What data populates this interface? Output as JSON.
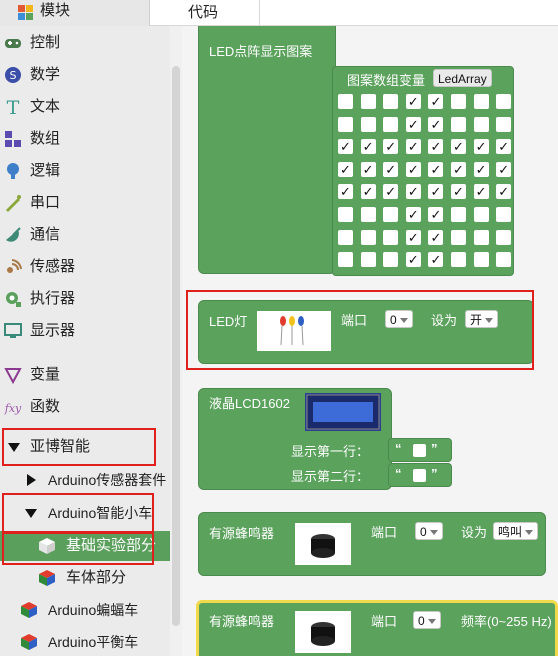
{
  "tabs": {
    "modules": "模块",
    "code": "代码"
  },
  "sidebar": {
    "items": [
      {
        "label": "控制",
        "icon": "gamepad-icon"
      },
      {
        "label": "数学",
        "icon": "math-icon"
      },
      {
        "label": "文本",
        "icon": "text-icon"
      },
      {
        "label": "数组",
        "icon": "array-icon"
      },
      {
        "label": "逻辑",
        "icon": "bulb-icon"
      },
      {
        "label": "串口",
        "icon": "serial-icon"
      },
      {
        "label": "通信",
        "icon": "satellite-icon"
      },
      {
        "label": "传感器",
        "icon": "sensor-icon"
      },
      {
        "label": "执行器",
        "icon": "actuator-icon"
      },
      {
        "label": "显示器",
        "icon": "monitor-icon"
      },
      {
        "label": "变量",
        "icon": "variable-icon"
      },
      {
        "label": "函数",
        "icon": "function-icon"
      }
    ],
    "group": "亚博智能",
    "sub1": "Arduino传感器套件",
    "sub2": "Arduino智能小车",
    "sub2_child1": "基础实验部分",
    "sub2_child2": "车体部分",
    "sub3": "Arduino蝙蝠车",
    "sub4": "Arduino平衡车"
  },
  "blocks": {
    "ledmatrix": {
      "title": "LED点阵显示图案",
      "array_label": "图案数组变量",
      "array_name": "LedArray",
      "grid": [
        [
          0,
          0,
          0,
          1,
          1,
          0,
          0,
          0
        ],
        [
          0,
          0,
          0,
          1,
          1,
          0,
          0,
          0
        ],
        [
          1,
          1,
          1,
          1,
          1,
          1,
          1,
          1
        ],
        [
          1,
          1,
          1,
          1,
          1,
          1,
          1,
          1
        ],
        [
          1,
          1,
          1,
          1,
          1,
          1,
          1,
          1
        ],
        [
          0,
          0,
          0,
          1,
          1,
          0,
          0,
          0
        ],
        [
          0,
          0,
          0,
          1,
          1,
          0,
          0,
          0
        ],
        [
          0,
          0,
          0,
          1,
          1,
          0,
          0,
          0
        ]
      ]
    },
    "led": {
      "title": "LED灯",
      "port_label": "端口",
      "port_value": "0",
      "set_label": "设为",
      "set_value": "开"
    },
    "lcd": {
      "title": "液晶LCD1602",
      "line1": "显示第一行：",
      "line2": "显示第二行："
    },
    "buzzer1": {
      "title": "有源蜂鸣器",
      "port_label": "端口",
      "port_value": "0",
      "set_label": "设为",
      "set_value": "鸣叫"
    },
    "buzzer2": {
      "title": "有源蜂鸣器",
      "port_label": "端口",
      "port_value": "0",
      "freq_label": "频率(0~255 Hz)"
    }
  },
  "colors": {
    "block": "#5ba25d",
    "highlight": "#e0201c",
    "selected": "#5aa05c"
  }
}
